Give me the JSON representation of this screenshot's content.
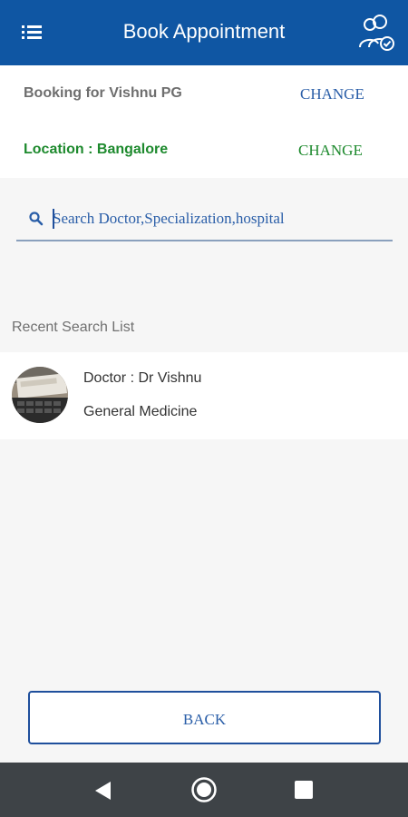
{
  "app_bar": {
    "title": "Book Appointment",
    "menu_icon": "menu-list-icon",
    "profile_icon": "switch-profile-icon",
    "color": "#0f56a3"
  },
  "booking": {
    "patient_text": "Booking for Vishnu PG",
    "patient_change": "CHANGE",
    "location_text": "Location : Bangalore",
    "location_change": "CHANGE",
    "location_color": "#1e8a2e"
  },
  "search": {
    "placeholder": "Search Doctor,Specialization,hospital",
    "value": "",
    "icon": "search-icon"
  },
  "recent": {
    "title": "Recent Search List",
    "items": [
      {
        "doctor": "Doctor : Dr Vishnu",
        "specialization": "General Medicine",
        "avatar_icon": "doctor-photo-avatar"
      }
    ]
  },
  "footer": {
    "back_label": "BACK"
  },
  "system_nav": {
    "back_icon": "nav-back-icon",
    "home_icon": "nav-home-icon",
    "recents_icon": "nav-recents-icon"
  }
}
